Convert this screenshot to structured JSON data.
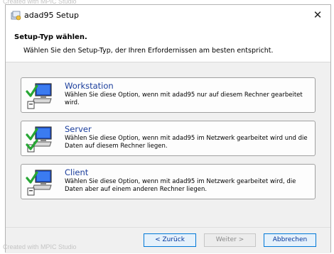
{
  "watermark": "Created with MPIC Studio",
  "window": {
    "title": "adad95 Setup",
    "close_glyph": "✕",
    "icon": "setup-app-icon"
  },
  "header": {
    "title": "Setup-Typ wählen.",
    "subtitle": "Wählen Sie den Setup-Typ, der Ihren Erfordernissen am besten entspricht."
  },
  "options": [
    {
      "title": "Workstation",
      "description": "Wählen Sie diese Option, wenn mit adad95 nur auf diesem Rechner gearbeitet wird.",
      "icon": "workstation-icon"
    },
    {
      "title": "Server",
      "description": "Wählen Sie diese Option, wenn mit adad95 im Netzwerk gearbeitet wird und die Daten auf diesem Rechner liegen.",
      "icon": "server-icon"
    },
    {
      "title": "Client",
      "description": "Wählen Sie diese Option, wenn mit adad95 im Netzwerk gearbeitet wird, die Daten aber auf einem anderen Rechner liegen.",
      "icon": "client-icon"
    }
  ],
  "buttons": {
    "back": "< Zurück",
    "next": "Weiter >",
    "cancel": "Abbrechen"
  },
  "colors": {
    "option_title": "#1a3d9c",
    "content_bg": "#f0f0f0",
    "button_focus_border": "#0078d7"
  }
}
